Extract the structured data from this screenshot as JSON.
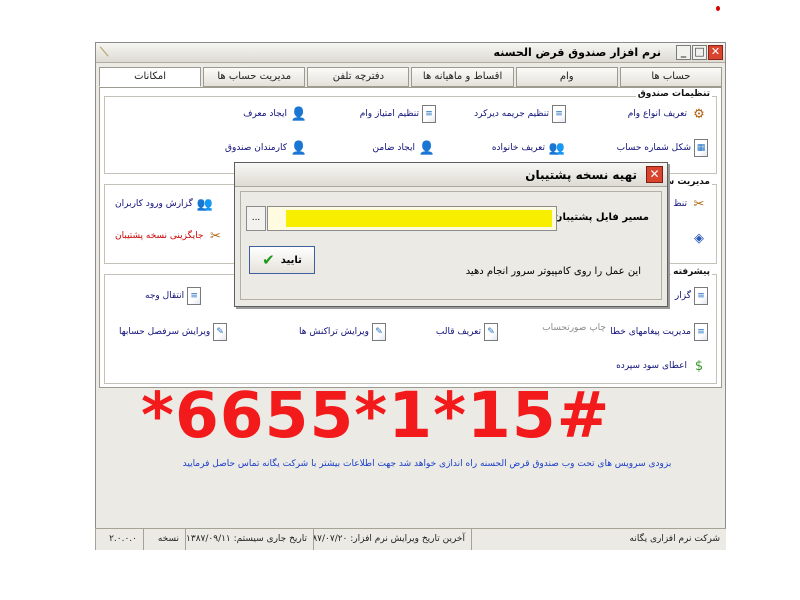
{
  "window": {
    "title": "نرم افزار صندوق قرض الحسنه"
  },
  "tabs": [
    "حساب ها",
    "وام",
    "اقساط و ماهیانه ها",
    "دفترچه تلفن",
    "مدیریت حساب ها",
    "امکانات"
  ],
  "groups": {
    "fund_settings": "تنظیمات صندوق",
    "account_management": "مدیریت سیستم",
    "advanced": "پیشرفته"
  },
  "items": {
    "loan_types": "تعریف انواع وام",
    "fine_settings": "تنظیم جریمه دیرکرد",
    "loan_points": "تنظیم امتیاز وام",
    "create_introducer": "ایجاد معرف",
    "account_number_format": "شکل شماره حساب",
    "family_definition": "تعریف خانواده",
    "create_guarantor": "ایجاد ضامن",
    "fund_staff": "کارمندان صندوق",
    "user_login_report": "گزارش ورود کاربران",
    "backup_location": "جایگزینی نسخه پشتیبان",
    "transfer_funds": "انتقال وجه",
    "error_messages": "مدیریت پیغامهای خطا",
    "print_statement": "چاپ صورتحساب",
    "define_template": "تعریف قالب",
    "edit_transactions": "ویرایش تراکنش ها",
    "edit_account_header": "ویرایش سرفصل حسابها",
    "deposit_interest": "اعطای سود سپرده",
    "partial_top_left": "تنظ",
    "partial_report": "گزار"
  },
  "dialog": {
    "title": "تهیه نسخه پشتیبان",
    "path_label": "مسیر فایل پشتیبان یگانه",
    "browse_label": "...",
    "note": "این عمل را روی کامپیوتر سرور انجام دهید",
    "ok_label": "تایید"
  },
  "overlay_code": "*6655*1*15#",
  "footer_text": "بزودی سرویس های تحت وب صندوق قرض الحسنه راه اندازی خواهد شد جهت اطلاعات بیشتر با شرکت یگانه تماس حاصل فرمایید",
  "status": {
    "company": "شرکت نرم افزاری یگانه",
    "last_version_date": "آخرین تاریخ ویرایش نرم افزار: ۱۳۸۷/۰۷/۲۰",
    "current_date": "تاریخ جاری سیستم: ۱۳۸۷/۰۹/۱۱",
    "edition": "نسخه",
    "version": "۲.۰.۰.۰"
  },
  "colors": {
    "overlay": "#f21a1a",
    "link_text": "#10107a",
    "footer_text": "#1a3ec8",
    "highlight": "#f8ee00"
  }
}
